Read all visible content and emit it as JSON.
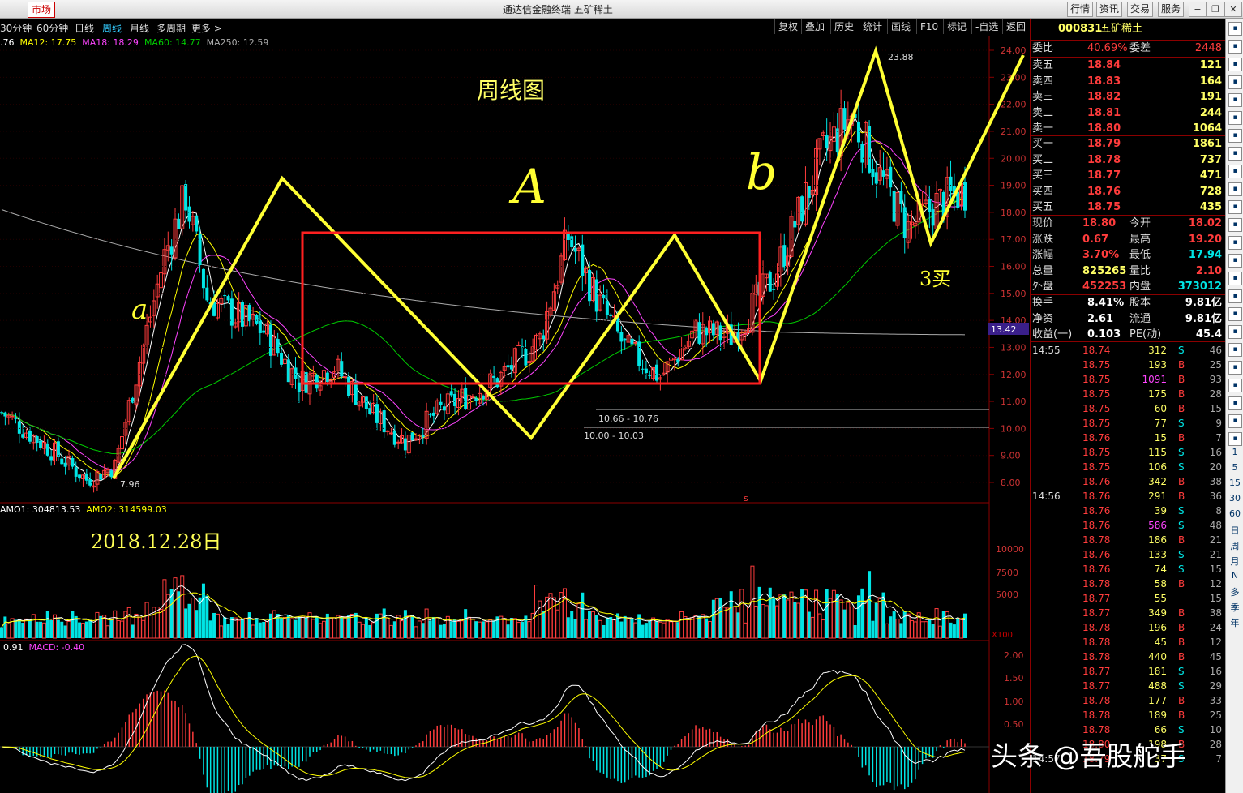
{
  "titlebar": {
    "tabs": [
      "市场"
    ],
    "title": "通达信金融终端  五矿稀土",
    "buttons": [
      "行情",
      "资讯",
      "交易",
      "服务"
    ]
  },
  "toolbar": {
    "periods": [
      "30分钟",
      "60分钟",
      "日线",
      "周线",
      "月线",
      "多周期",
      "更多 >"
    ],
    "active_period": "周线",
    "actions": [
      "复权",
      "叠加",
      "历史",
      "统计",
      "画线",
      "F10",
      "标记",
      "-自选",
      "返回"
    ]
  },
  "ma_legend": {
    "ma5": ".76",
    "ma12": "MA12: 17.75",
    "ma18": "MA18: 18.29",
    "ma60": "MA60: 14.77",
    "ma250": "MA250: 12.59"
  },
  "colors": {
    "up": "#ff3c3c",
    "down": "#00e5e5",
    "ma5": "#ffffff",
    "ma12": "#ffff00",
    "ma18": "#ff44ff",
    "ma60": "#00cc00",
    "ma250": "#aaaaaa",
    "annotation": "#ffff33",
    "box": "#ff2020"
  },
  "annotations": {
    "chart_type": "周线图",
    "wave_a_small": "a",
    "wave_A": "A",
    "wave_b": "b",
    "buy3": "3买",
    "date": "2018.12.28日"
  },
  "chart_data": {
    "type": "candlestick",
    "price_axis": {
      "ticks": [
        "24.00",
        "23.00",
        "22.00",
        "21.00",
        "20.00",
        "19.00",
        "18.00",
        "17.00",
        "16.00",
        "15.00",
        "14.00",
        "13.00",
        "12.00",
        "11.00",
        "10.00",
        "9.00",
        "8.00"
      ],
      "range": [
        7.5,
        24.3
      ]
    },
    "current_price_tag": "13.42",
    "price_labels": {
      "high": "23.88",
      "low": "7.96",
      "range1": "10.66 - 10.76",
      "range2": "10.00 - 10.03"
    },
    "volume": {
      "legend1": "AMO1: 304813.53",
      "legend2": "AMO2: 314599.03",
      "ticks": [
        "10000",
        "7500",
        "5000"
      ],
      "unit": "X100"
    },
    "macd": {
      "legend1": "0.91",
      "legend2": "MACD: -0.40",
      "ticks": [
        "2.00",
        "1.50",
        "1.00",
        "0.50"
      ]
    }
  },
  "quote": {
    "code": "000831",
    "name": "五矿稀土",
    "weibi_label": "委比",
    "weibi": "40.69%",
    "weicha_label": "委差",
    "weicha": "2448",
    "asks": [
      {
        "label": "卖五",
        "price": "18.84",
        "vol": "121"
      },
      {
        "label": "卖四",
        "price": "18.83",
        "vol": "164"
      },
      {
        "label": "卖三",
        "price": "18.82",
        "vol": "191"
      },
      {
        "label": "卖二",
        "price": "18.81",
        "vol": "244"
      },
      {
        "label": "卖一",
        "price": "18.80",
        "vol": "1064"
      }
    ],
    "bids": [
      {
        "label": "买一",
        "price": "18.79",
        "vol": "1861"
      },
      {
        "label": "买二",
        "price": "18.78",
        "vol": "737"
      },
      {
        "label": "买三",
        "price": "18.77",
        "vol": "471"
      },
      {
        "label": "买四",
        "price": "18.76",
        "vol": "728"
      },
      {
        "label": "买五",
        "price": "18.75",
        "vol": "435"
      }
    ],
    "stats": [
      {
        "l1": "现价",
        "v1": "18.80",
        "l2": "今开",
        "v2": "18.02"
      },
      {
        "l1": "涨跌",
        "v1": "0.67",
        "l2": "最高",
        "v2": "19.20"
      },
      {
        "l1": "涨幅",
        "v1": "3.70%",
        "l2": "最低",
        "v2": "17.94"
      },
      {
        "l1": "总量",
        "v1": "825265",
        "l2": "量比",
        "v2": "2.10"
      },
      {
        "l1": "外盘",
        "v1": "452253",
        "l2": "内盘",
        "v2": "373012"
      }
    ],
    "stats2": [
      {
        "l1": "换手",
        "v1": "8.41%",
        "l2": "股本",
        "v2": "9.81亿"
      },
      {
        "l1": "净资",
        "v1": "2.61",
        "l2": "流通",
        "v2": "9.81亿"
      },
      {
        "l1": "收益(一)",
        "v1": "0.103",
        "l2": "PE(动)",
        "v2": "45.4"
      }
    ]
  },
  "ticks": [
    {
      "time": "14:55",
      "price": "18.74",
      "vol": "312",
      "bs": "S",
      "n": "46"
    },
    {
      "time": "",
      "price": "18.75",
      "vol": "193",
      "bs": "B",
      "n": "25"
    },
    {
      "time": "",
      "price": "18.75",
      "vol": "1091",
      "bs": "B",
      "n": "93"
    },
    {
      "time": "",
      "price": "18.75",
      "vol": "175",
      "bs": "B",
      "n": "28"
    },
    {
      "time": "",
      "price": "18.75",
      "vol": "60",
      "bs": "B",
      "n": "15"
    },
    {
      "time": "",
      "price": "18.75",
      "vol": "77",
      "bs": "S",
      "n": "9"
    },
    {
      "time": "",
      "price": "18.76",
      "vol": "15",
      "bs": "B",
      "n": "7"
    },
    {
      "time": "",
      "price": "18.75",
      "vol": "115",
      "bs": "S",
      "n": "16"
    },
    {
      "time": "",
      "price": "18.75",
      "vol": "106",
      "bs": "S",
      "n": "20"
    },
    {
      "time": "",
      "price": "18.76",
      "vol": "342",
      "bs": "B",
      "n": "38"
    },
    {
      "time": "14:56",
      "price": "18.76",
      "vol": "291",
      "bs": "B",
      "n": "36"
    },
    {
      "time": "",
      "price": "18.76",
      "vol": "39",
      "bs": "S",
      "n": "8"
    },
    {
      "time": "",
      "price": "18.76",
      "vol": "586",
      "bs": "S",
      "n": "48"
    },
    {
      "time": "",
      "price": "18.78",
      "vol": "186",
      "bs": "B",
      "n": "21"
    },
    {
      "time": "",
      "price": "18.76",
      "vol": "133",
      "bs": "S",
      "n": "21"
    },
    {
      "time": "",
      "price": "18.76",
      "vol": "74",
      "bs": "S",
      "n": "15"
    },
    {
      "time": "",
      "price": "18.78",
      "vol": "58",
      "bs": "B",
      "n": "12"
    },
    {
      "time": "",
      "price": "18.77",
      "vol": "55",
      "bs": "",
      "n": "15"
    },
    {
      "time": "",
      "price": "18.77",
      "vol": "349",
      "bs": "B",
      "n": "38"
    },
    {
      "time": "",
      "price": "18.78",
      "vol": "196",
      "bs": "B",
      "n": "24"
    },
    {
      "time": "",
      "price": "18.78",
      "vol": "45",
      "bs": "B",
      "n": "12"
    },
    {
      "time": "",
      "price": "18.78",
      "vol": "440",
      "bs": "B",
      "n": "45"
    },
    {
      "time": "",
      "price": "18.77",
      "vol": "181",
      "bs": "S",
      "n": "16"
    },
    {
      "time": "",
      "price": "18.77",
      "vol": "488",
      "bs": "S",
      "n": "29"
    },
    {
      "time": "",
      "price": "18.78",
      "vol": "177",
      "bs": "B",
      "n": "33"
    },
    {
      "time": "",
      "price": "18.78",
      "vol": "189",
      "bs": "B",
      "n": "25"
    },
    {
      "time": "",
      "price": "18.78",
      "vol": "66",
      "bs": "S",
      "n": "10"
    },
    {
      "time": "",
      "price": "18.80",
      "vol": "198",
      "bs": "B",
      "n": "28"
    },
    {
      "time": "14:57",
      "price": "18.79",
      "vol": "37",
      "bs": "S",
      "n": "7"
    }
  ],
  "side_labels": [
    "1",
    "5",
    "15",
    "30",
    "60",
    "日",
    "周",
    "月",
    "N",
    "多",
    "季",
    "年"
  ],
  "watermark": "头条 @吾股舵手"
}
